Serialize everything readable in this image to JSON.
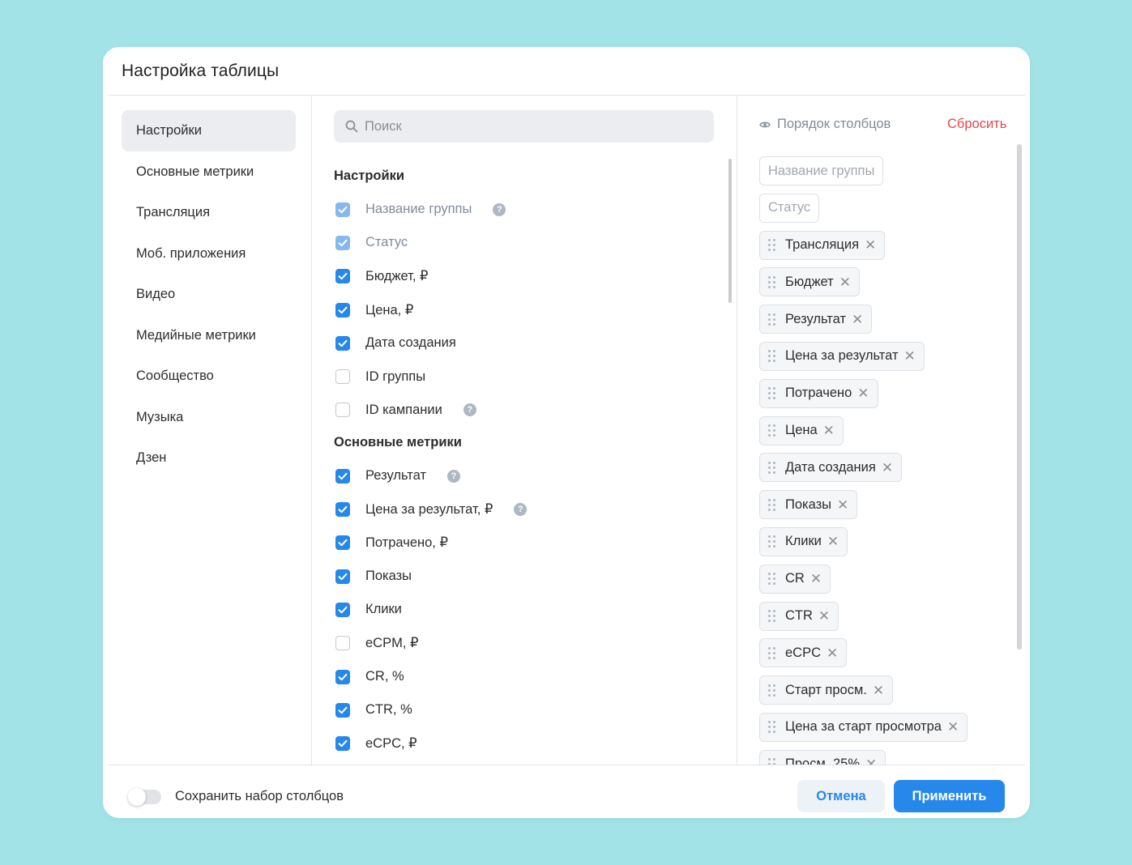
{
  "dialog": {
    "title": "Настройка таблицы"
  },
  "nav": {
    "items": [
      {
        "label": "Настройки",
        "active": true
      },
      {
        "label": "Основные метрики"
      },
      {
        "label": "Трансляция"
      },
      {
        "label": "Моб. приложения"
      },
      {
        "label": "Видео"
      },
      {
        "label": "Медийные метрики"
      },
      {
        "label": "Сообщество"
      },
      {
        "label": "Музыка"
      },
      {
        "label": "Дзен"
      }
    ]
  },
  "search": {
    "placeholder": "Поиск",
    "value": ""
  },
  "sections": [
    {
      "title": "Настройки",
      "items": [
        {
          "label": "Название группы",
          "state": "checked-disabled",
          "help": true
        },
        {
          "label": "Статус",
          "state": "checked-disabled",
          "help": false
        },
        {
          "label": "Бюджет, ₽",
          "state": "checked",
          "help": false
        },
        {
          "label": "Цена, ₽",
          "state": "checked",
          "help": false
        },
        {
          "label": "Дата создания",
          "state": "checked",
          "help": false
        },
        {
          "label": "ID группы",
          "state": "unchecked",
          "help": false
        },
        {
          "label": "ID кампании",
          "state": "unchecked",
          "help": true
        }
      ]
    },
    {
      "title": "Основные метрики",
      "items": [
        {
          "label": "Результат",
          "state": "checked",
          "help": true
        },
        {
          "label": "Цена за результат, ₽",
          "state": "checked",
          "help": true
        },
        {
          "label": "Потрачено, ₽",
          "state": "checked",
          "help": false
        },
        {
          "label": "Показы",
          "state": "checked",
          "help": false
        },
        {
          "label": "Клики",
          "state": "checked",
          "help": false
        },
        {
          "label": "eCPM, ₽",
          "state": "unchecked",
          "help": false
        },
        {
          "label": "CR, %",
          "state": "checked",
          "help": false
        },
        {
          "label": "CTR, %",
          "state": "checked",
          "help": false
        },
        {
          "label": "eCPC, ₽",
          "state": "checked",
          "help": false
        }
      ]
    }
  ],
  "order": {
    "title": "Порядок столбцов",
    "reset_label": "Сбросить",
    "columns": [
      {
        "label": "Название группы",
        "fixed": true
      },
      {
        "label": "Статус",
        "fixed": true
      },
      {
        "label": "Трансляция"
      },
      {
        "label": "Бюджет"
      },
      {
        "label": "Результат"
      },
      {
        "label": "Цена за результат"
      },
      {
        "label": "Потрачено"
      },
      {
        "label": "Цена"
      },
      {
        "label": "Дата создания"
      },
      {
        "label": "Показы"
      },
      {
        "label": "Клики"
      },
      {
        "label": "CR"
      },
      {
        "label": "CTR"
      },
      {
        "label": "eCPC"
      },
      {
        "label": "Старт просм."
      },
      {
        "label": "Цена за старт просмотра"
      },
      {
        "label": "Просм. 25%"
      }
    ]
  },
  "footer": {
    "save_set_label": "Сохранить набор столбцов",
    "save_set_enabled": false,
    "cancel_label": "Отмена",
    "apply_label": "Применить"
  },
  "colors": {
    "accent": "#2688eb",
    "danger": "#e64646",
    "background": "#a2e3e8"
  }
}
